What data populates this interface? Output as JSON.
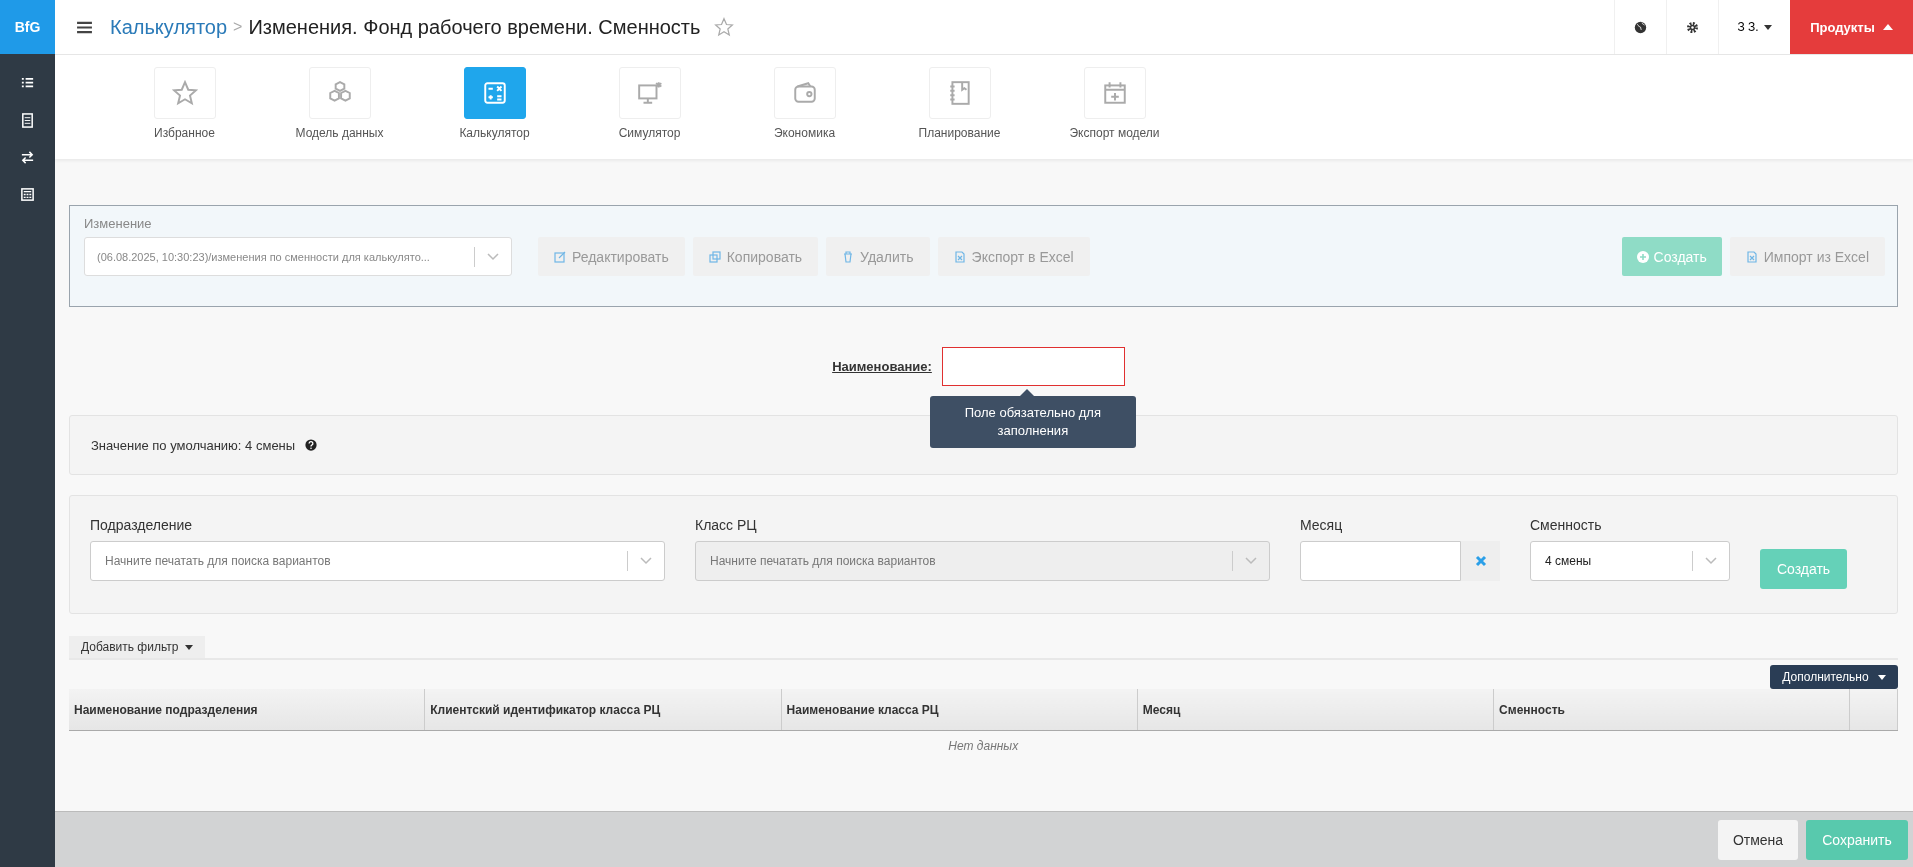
{
  "logo": "BfG",
  "breadcrumb": {
    "parent": "Калькулятор",
    "separator": ">",
    "title": "Изменения. Фонд рабочего времени. Сменность"
  },
  "topbar": {
    "user": "З З.",
    "products": "Продукты"
  },
  "modules": [
    {
      "label": "Избранное",
      "selected": false
    },
    {
      "label": "Модель данных",
      "selected": false
    },
    {
      "label": "Калькулятор",
      "selected": true
    },
    {
      "label": "Симулятор",
      "selected": false
    },
    {
      "label": "Экономика",
      "selected": false
    },
    {
      "label": "Планирование",
      "selected": false
    },
    {
      "label": "Экспорт модели",
      "selected": false
    }
  ],
  "change": {
    "label": "Изменение",
    "value": "(06.08.2025, 10:30:23)/изменения по сменности для калькулято...",
    "actions": [
      {
        "label": "Редактировать",
        "disabled": true
      },
      {
        "label": "Копировать",
        "disabled": true
      },
      {
        "label": "Удалить",
        "disabled": true
      },
      {
        "label": "Экспорт в Excel",
        "disabled": true
      }
    ],
    "create": {
      "label": "Создать",
      "disabled": true
    },
    "import": {
      "label": "Импорт из Excel",
      "disabled": true
    }
  },
  "name_field": {
    "label": "Наименование:",
    "invalid": true,
    "tooltip": "Поле обязательно для заполнения"
  },
  "default_value": "Значение по умолчанию: 4 смены",
  "filters": {
    "department": {
      "label": "Подразделение",
      "placeholder": "Начните печатать для поиска вариантов",
      "disabled": false
    },
    "class": {
      "label": "Класс РЦ",
      "placeholder": "Начните печатать для поиска вариантов",
      "disabled": true
    },
    "month": {
      "label": "Месяц"
    },
    "shift": {
      "label": "Сменность",
      "value": "4 смены"
    },
    "create": "Создать"
  },
  "add_filter": "Добавить фильтр",
  "more": "Дополнительно",
  "table": {
    "columns": [
      "Наименование подразделения",
      "Клиентский идентификатор класса РЦ",
      "Наименование класса РЦ",
      "Месяц",
      "Сменность"
    ],
    "empty": "Нет данных"
  },
  "footer": {
    "cancel": "Отмена",
    "save": "Сохранить"
  }
}
